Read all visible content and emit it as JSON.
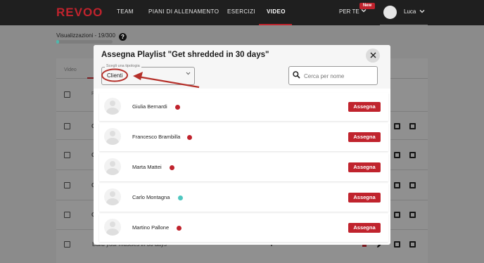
{
  "brand": {
    "logo": "REVOO",
    "accent": "#c0232d"
  },
  "nav": {
    "items": [
      "TEAM",
      "PIANI DI ALLENAMENTO",
      "ESERCIZI",
      "VIDEO"
    ],
    "active": "VIDEO",
    "perte": "PER TE",
    "new_badge": "New",
    "user": "Luca"
  },
  "background": {
    "visualizzazioni": "Visualizzazioni - 19/300",
    "progress": 0.063,
    "tab_video": "Video",
    "col_p": "P",
    "last_row_text": "Build your muscles in 30 days",
    "row_letter": "C"
  },
  "modal": {
    "title": "Assegna Playlist \"Get shredded in 30 days\"",
    "select_label": "Scegli una tipologia",
    "select_value": "Clienti",
    "search_placeholder": "Cerca per nome",
    "assign_label": "Assegna",
    "clients": [
      {
        "name": "Giulia Bernardi",
        "status_color": "#c0232d"
      },
      {
        "name": "Francesco Brambilla",
        "status_color": "#c0232d"
      },
      {
        "name": "Marta Mattei",
        "status_color": "#c0232d"
      },
      {
        "name": "Carlo Montagna",
        "status_color": "#4fc7c0"
      },
      {
        "name": "Martino Pallone",
        "status_color": "#c0232d"
      }
    ]
  },
  "annotation": {
    "color": "#b5302a"
  }
}
